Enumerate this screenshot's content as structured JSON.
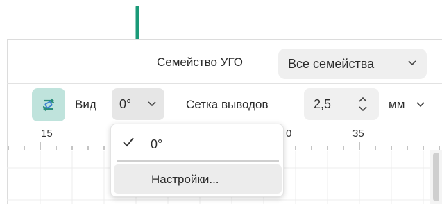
{
  "header": {
    "family_label": "Семейство УГО",
    "family_value": "Все семейства"
  },
  "toolbar": {
    "sync_icon": "sync-arrows-icon",
    "view_label": "Вид",
    "view_value": "0°",
    "grid_label": "Сетка выводов",
    "grid_value": "2,5",
    "unit_value": "мм"
  },
  "ruler": {
    "labels": [
      "15",
      "0",
      "35"
    ]
  },
  "view_menu": {
    "items": [
      {
        "label": "0°",
        "selected": true
      },
      {
        "label": "Настройки..."
      }
    ]
  },
  "colors": {
    "annotation_arrow": "#1a9a78",
    "sync_button_bg": "#bfe3dc",
    "sync_icon": "#2a8c7a"
  }
}
